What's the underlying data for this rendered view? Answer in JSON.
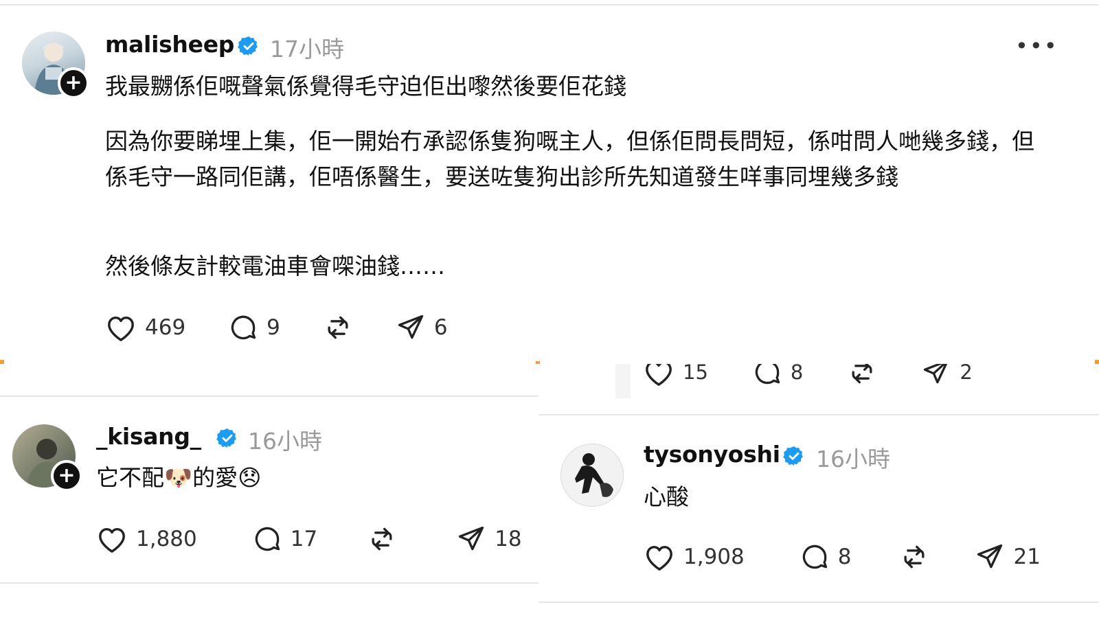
{
  "post_main": {
    "username": "malisheep",
    "time": "17小時",
    "follow_symbol": "+",
    "more": "•••",
    "paragraphs": [
      "我最嬲係佢嘅聲氣係覺得毛守迫佢出嚟然後要佢花錢",
      "因為你要睇埋上集，佢一開始冇承認係隻狗嘅主人，但係佢問長問短，係咁問人哋幾多錢，但係毛守一路同佢講，佢唔係醫生，要送咗隻狗出診所先知道發生咩事同埋幾多錢",
      "然後條友計較電油車會㗎油錢……"
    ],
    "likes": "469",
    "comments": "9",
    "shares": "6"
  },
  "partial_row": {
    "likes": "15",
    "comments": "8",
    "shares": "2"
  },
  "post_kisang": {
    "username": "_kisang_",
    "time": "16小時",
    "follow_symbol": "+",
    "text": "它不配🐶的愛😞",
    "likes": "1,880",
    "comments": "17",
    "shares": "18"
  },
  "post_tyson": {
    "username": "tysonyoshi",
    "time": "16小時",
    "text": "心酸",
    "likes": "1,908",
    "comments": "8",
    "shares": "21"
  },
  "colors": {
    "verified": "#1d9bf0",
    "muted": "#9a9a9a",
    "text": "#111111",
    "accent_marker": "#f0a030"
  }
}
